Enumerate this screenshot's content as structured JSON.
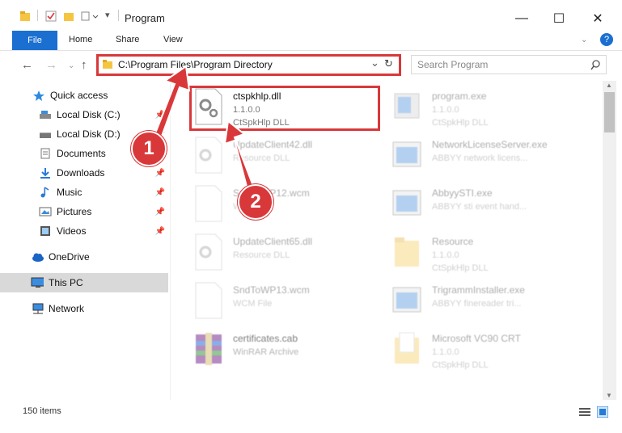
{
  "window": {
    "title": "Program",
    "minimize": "—",
    "maximize": "☐",
    "close": "✕"
  },
  "ribbon": {
    "file": "File",
    "home": "Home",
    "share": "Share",
    "view": "View",
    "help": "?"
  },
  "address": {
    "path": "C:\\Program Files\\Program Directory",
    "dropdown": "⌄",
    "refresh": "↻"
  },
  "search": {
    "placeholder": "Search Program"
  },
  "sidebar": {
    "items": [
      {
        "label": "Quick access",
        "icon": "star-icon"
      },
      {
        "label": "Local Disk (C:)",
        "icon": "drive-icon"
      },
      {
        "label": "Local Disk (D:)",
        "icon": "drive-icon"
      },
      {
        "label": "Documents",
        "icon": "documents-icon"
      },
      {
        "label": "Downloads",
        "icon": "download-icon"
      },
      {
        "label": "Music",
        "icon": "music-icon"
      },
      {
        "label": "Pictures",
        "icon": "pictures-icon"
      },
      {
        "label": "Videos",
        "icon": "videos-icon"
      },
      {
        "label": "OneDrive",
        "icon": "cloud-icon"
      },
      {
        "label": "This PC",
        "icon": "pc-icon"
      },
      {
        "label": "Network",
        "icon": "network-icon"
      }
    ]
  },
  "files": {
    "f1": {
      "name": "ctspkhlp.dll",
      "l2": "1.1.0.0",
      "l3": "CtSpkHlp DLL"
    },
    "f2": {
      "name": "UpdateClient42.dll",
      "l2": "Resource DLL",
      "l3": ""
    },
    "f3": {
      "name": "SndToWP12.wcm",
      "l2": "WCM File",
      "l3": ""
    },
    "f4": {
      "name": "UpdateClient65.dll",
      "l2": "Resource DLL",
      "l3": ""
    },
    "f5": {
      "name": "SndToWP13.wcm",
      "l2": "WCM File",
      "l3": ""
    },
    "f6": {
      "name": "certificates.cab",
      "l2": "WinRAR Archive",
      "l3": ""
    },
    "f7": {
      "name": "program.exe",
      "l2": "1.1.0.0",
      "l3": "CtSpkHlp DLL"
    },
    "f8": {
      "name": "NetworkLicenseServer.exe",
      "l2": "ABBYY network licens...",
      "l3": ""
    },
    "f9": {
      "name": "AbbyySTI.exe",
      "l2": "ABBYY sti event hand...",
      "l3": ""
    },
    "f10": {
      "name": "Resource",
      "l2": "1.1.0.0",
      "l3": "CtSpkHlp DLL"
    },
    "f11": {
      "name": "TrigrammInstaller.exe",
      "l2": "ABBYY finereader tri...",
      "l3": ""
    },
    "f12": {
      "name": "Microsoft VC90 CRT",
      "l2": "1.1.0.0",
      "l3": "CtSpkHlp DLL"
    }
  },
  "status": {
    "count": "150 items"
  },
  "badges": {
    "one": "1",
    "two": "2"
  },
  "colors": {
    "accent": "#1a6fd1",
    "highlight": "#d9383a"
  }
}
